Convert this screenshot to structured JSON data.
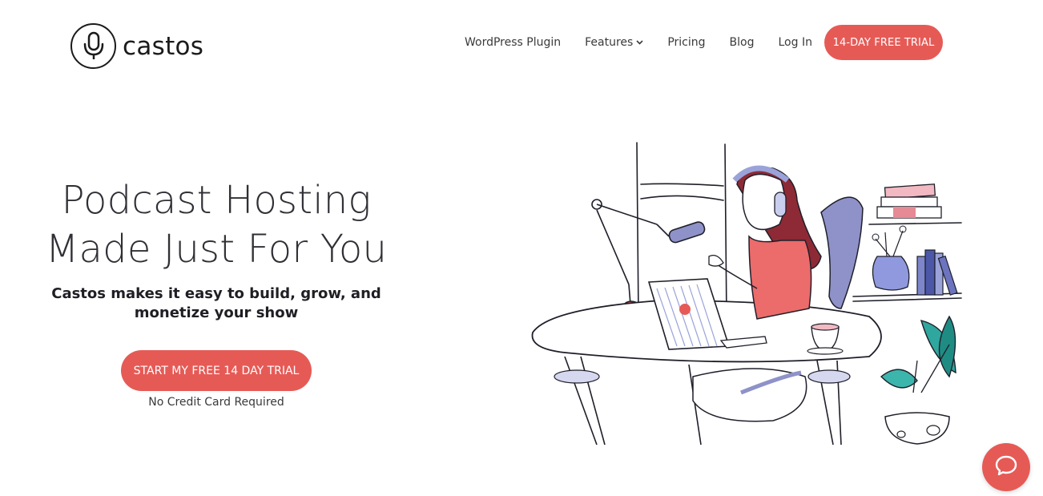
{
  "brand": {
    "name": "castos",
    "accent_color": "#e65a56",
    "logo_icon": "microphone-icon"
  },
  "nav": {
    "items": [
      {
        "label": "WordPress Plugin"
      },
      {
        "label": "Features",
        "icon": "chevron-down-icon"
      },
      {
        "label": "Pricing"
      },
      {
        "label": "Blog"
      },
      {
        "label": "Log In"
      }
    ],
    "cta_label": "14-DAY FREE TRIAL"
  },
  "hero": {
    "title_line1": "Podcast Hosting",
    "title_line2": "Made Just For You",
    "subtitle": "Castos makes it easy to build, grow, and monetize your show",
    "cta_label": "START MY FREE 14 DAY TRIAL",
    "note": "No Credit Card Required"
  },
  "illustration": {
    "subject": "podcaster-at-desk-illustration"
  },
  "chat": {
    "icon": "chat-bubble-icon"
  }
}
